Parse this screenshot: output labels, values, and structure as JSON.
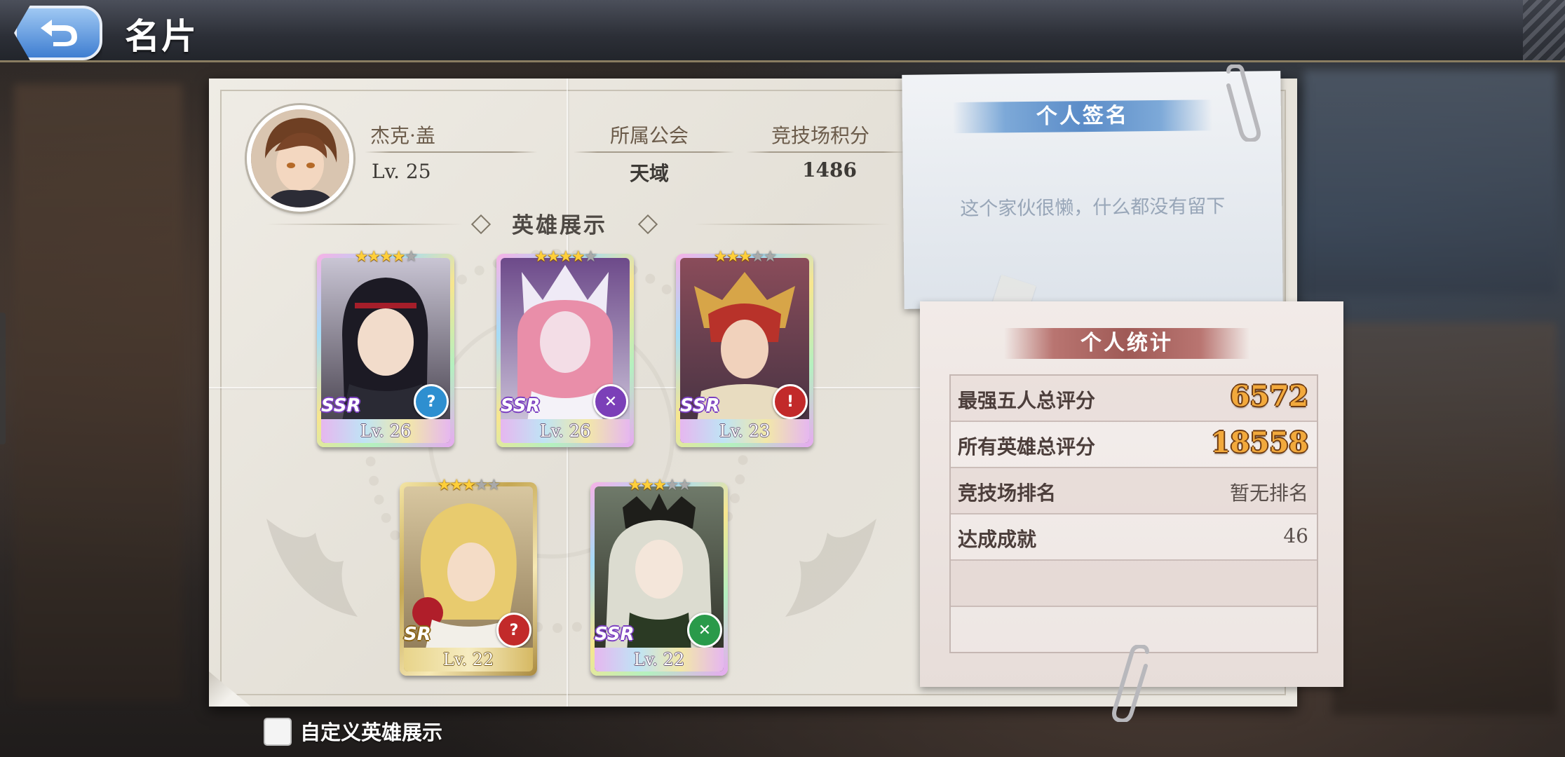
{
  "header": {
    "title": "名片",
    "back_icon": "back-arrow-icon"
  },
  "profile": {
    "name": "杰克·盖",
    "level": "Lv. 25",
    "guild_label": "所属公会",
    "guild_value": "天域",
    "arena_points_label": "竞技场积分",
    "arena_points_value": "1486"
  },
  "hero_showcase": {
    "title": "英雄展示",
    "heroes": [
      {
        "rarity": "SSR",
        "level": "Lv. 26",
        "stars": 4,
        "class_icon": "question-mark-icon",
        "class_color": "#2e8fd0"
      },
      {
        "rarity": "SSR",
        "level": "Lv. 26",
        "stars": 4,
        "class_icon": "crossed-swords-icon",
        "class_color": "#7b3fb8"
      },
      {
        "rarity": "SSR",
        "level": "Lv. 23",
        "stars": 3,
        "class_icon": "sword-icon",
        "class_color": "#c22a2a"
      },
      {
        "rarity": "SR",
        "level": "Lv. 22",
        "stars": 3,
        "class_icon": "question-mark-icon",
        "class_color": "#c22a2a"
      },
      {
        "rarity": "SSR",
        "level": "Lv. 22",
        "stars": 3,
        "class_icon": "crossed-swords-icon",
        "class_color": "#2a9a4a"
      }
    ],
    "max_stars": 5
  },
  "signature": {
    "title": "个人签名",
    "text": "这个家伙很懒，什么都没有留下"
  },
  "stats": {
    "title": "个人统计",
    "rows": [
      {
        "label": "最强五人总评分",
        "value": "6572"
      },
      {
        "label": "所有英雄总评分",
        "value": "18558"
      },
      {
        "label": "竞技场排名",
        "value": "暂无排名"
      },
      {
        "label": "达成成就",
        "value": "46"
      },
      {
        "label": "",
        "value": ""
      },
      {
        "label": "",
        "value": ""
      }
    ]
  },
  "custom_showcase": {
    "label": "自定义英雄展示",
    "checked": false
  }
}
